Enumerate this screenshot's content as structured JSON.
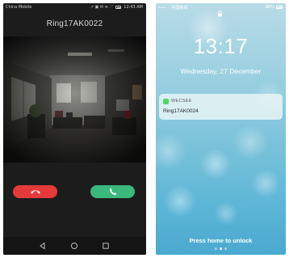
{
  "android": {
    "status": {
      "carrier": "China Mobile",
      "right": "↗ ▣ ✉ ≡ .ˡ ˡ ",
      "time": "12:43 AM"
    },
    "caller_name": "Ring17AK0022",
    "decline_icon": "phone-hangup-icon",
    "answer_icon": "phone-answer-icon",
    "nav": [
      "back-icon",
      "home-icon",
      "recents-icon"
    ],
    "colors": {
      "decline": "#e53a3a",
      "answer": "#3bb87b"
    }
  },
  "ios": {
    "status": {
      "carrier": "•••◦◦ 中国移动",
      "battery": "88%"
    },
    "time": "13:17",
    "date": "Wednesday, 27 December",
    "notification": {
      "app": "WECSEE",
      "message": "Ring17AK0024"
    },
    "unlock_hint": "Press home to unlock"
  }
}
